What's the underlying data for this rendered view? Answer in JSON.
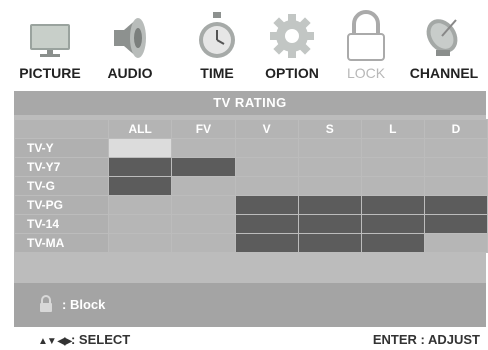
{
  "menu": {
    "items": [
      {
        "label": "PICTURE",
        "icon": "monitor-icon",
        "active": false
      },
      {
        "label": "AUDIO",
        "icon": "speaker-icon",
        "active": false
      },
      {
        "label": "TIME",
        "icon": "stopwatch-icon",
        "active": false
      },
      {
        "label": "OPTION",
        "icon": "gear-icon",
        "active": false
      },
      {
        "label": "LOCK",
        "icon": "padlock-icon",
        "active": true
      },
      {
        "label": "CHANNEL",
        "icon": "satellite-dish-icon",
        "active": false
      }
    ]
  },
  "rating": {
    "title": "TV RATING",
    "columns": [
      "ALL",
      "FV",
      "V",
      "S",
      "L",
      "D"
    ],
    "rows": [
      {
        "label": "TV-Y",
        "cells": [
          "selected",
          "open",
          "open",
          "open",
          "open",
          "open"
        ]
      },
      {
        "label": "TV-Y7",
        "cells": [
          "blocked",
          "blocked",
          "open",
          "open",
          "open",
          "open"
        ]
      },
      {
        "label": "TV-G",
        "cells": [
          "blocked",
          "open",
          "open",
          "open",
          "open",
          "open"
        ]
      },
      {
        "label": "TV-PG",
        "cells": [
          "open",
          "open",
          "blocked",
          "blocked",
          "blocked",
          "blocked"
        ]
      },
      {
        "label": "TV-14",
        "cells": [
          "open",
          "open",
          "blocked",
          "blocked",
          "blocked",
          "blocked"
        ]
      },
      {
        "label": "TV-MA",
        "cells": [
          "open",
          "open",
          "blocked",
          "blocked",
          "blocked",
          "open"
        ]
      }
    ]
  },
  "legend": {
    "icon": "padlock-icon",
    "text": ": Block"
  },
  "footer": {
    "arrows": "▲▼ ◀▶",
    "select": ": SELECT",
    "enter": "ENTER : ADJUST"
  },
  "colors": {
    "panel": "#bcbcbc",
    "header": "#a8a8a8",
    "blocked": "#5c5c5c",
    "open": "#b6b6b6",
    "selected": "#dcdcdc"
  }
}
